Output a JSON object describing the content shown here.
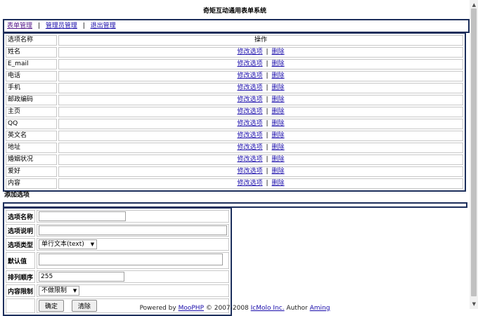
{
  "page_title": "奇矩互动通用表单系统",
  "nav": {
    "items": [
      "表单管理",
      "管理员管理",
      "退出管理"
    ],
    "separators": [
      "|",
      "|"
    ]
  },
  "table": {
    "header": {
      "name": "选项名称",
      "ops": "操作"
    },
    "edit_label": "修改选项",
    "delete_label": "删除",
    "bar": "|",
    "rows": [
      "姓名",
      "E_mail",
      "电话",
      "手机",
      "邮政编码",
      "主页",
      "QQ",
      "英文名",
      "地址",
      "婚姻状况",
      "爱好",
      "内容"
    ]
  },
  "add_section": {
    "title": "添加选项",
    "fields": {
      "name_label": "选项名称",
      "desc_label": "选项说明",
      "type_label": "选项类型",
      "type_value": "单行文本(text)",
      "default_label": "默认值",
      "order_label": "排列顺序",
      "order_value": "255",
      "limit_label": "内容限制",
      "limit_value": "不做限制"
    },
    "buttons": {
      "ok": "确定",
      "clear": "清除"
    }
  },
  "footer": {
    "powered": "Powered by ",
    "link1": "MooPHP",
    "mid": " © 2007-2008 ",
    "link2": "IcMolo Inc.",
    "author": " Author ",
    "link3": "Aming"
  }
}
